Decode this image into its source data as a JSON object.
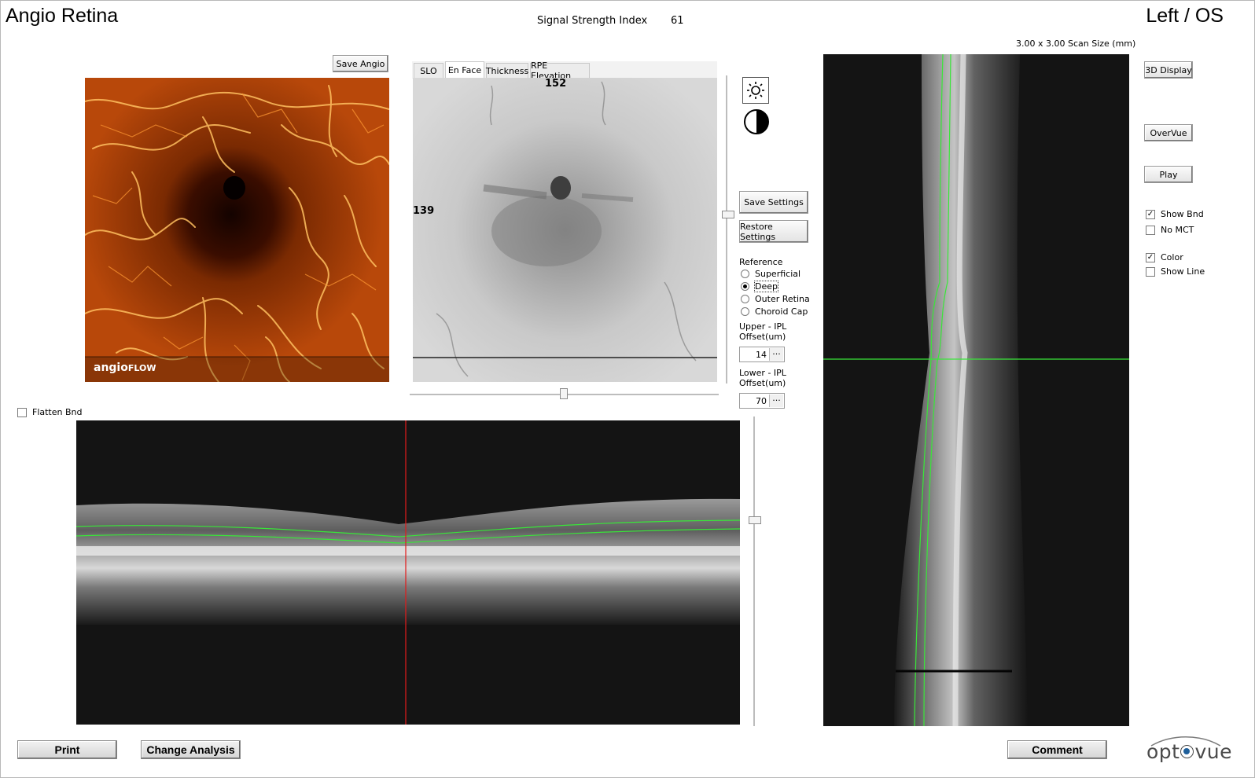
{
  "header": {
    "title": "Angio Retina",
    "eye": "Left / OS",
    "signal_label": "Signal Strength Index",
    "signal_value": "61",
    "scan_size": "3.00 x 3.00 Scan Size (mm)"
  },
  "angio": {
    "save_button": "Save Angio",
    "logo_angio": "angio",
    "logo_flow": "FLOW"
  },
  "enface": {
    "tabs": [
      "SLO",
      "En Face",
      "Thickness",
      "RPE Elevation"
    ],
    "active_tab": "En Face",
    "top_value": "152",
    "left_value": "139"
  },
  "controls": {
    "brightness_icon": "brightness-icon",
    "contrast_icon": "contrast-icon",
    "save_settings": "Save Settings",
    "restore_settings": "Restore Settings",
    "reference_label": "Reference",
    "reference_options": [
      "Superficial",
      "Deep",
      "Outer Retina",
      "Choroid Cap"
    ],
    "reference_selected": "Deep",
    "upper_label_1": "Upper - IPL",
    "upper_label_2": "Offset(um)",
    "upper_value": "14",
    "lower_label_1": "Lower - IPL",
    "lower_label_2": "Offset(um)",
    "lower_value": "70",
    "ellipsis": "..."
  },
  "bscan": {
    "flatten_label": "Flatten Bnd",
    "flatten_checked": false
  },
  "right_panel": {
    "display_3d": "3D Display",
    "overvue": "OverVue",
    "play": "Play",
    "show_bnd": "Show Bnd",
    "show_bnd_checked": true,
    "no_mct": "No MCT",
    "no_mct_checked": false,
    "color": "Color",
    "color_checked": true,
    "show_line": "Show Line",
    "show_line_checked": false
  },
  "footer": {
    "print": "Print",
    "change_analysis": "Change Analysis",
    "comment": "Comment",
    "brand_a": "opt",
    "brand_b": "vue"
  },
  "colors": {
    "boundary": "#39e639",
    "cursor_red": "#e21b1b",
    "angio_bg": "#5a1a00",
    "angio_vessel": "#ffb84a"
  }
}
